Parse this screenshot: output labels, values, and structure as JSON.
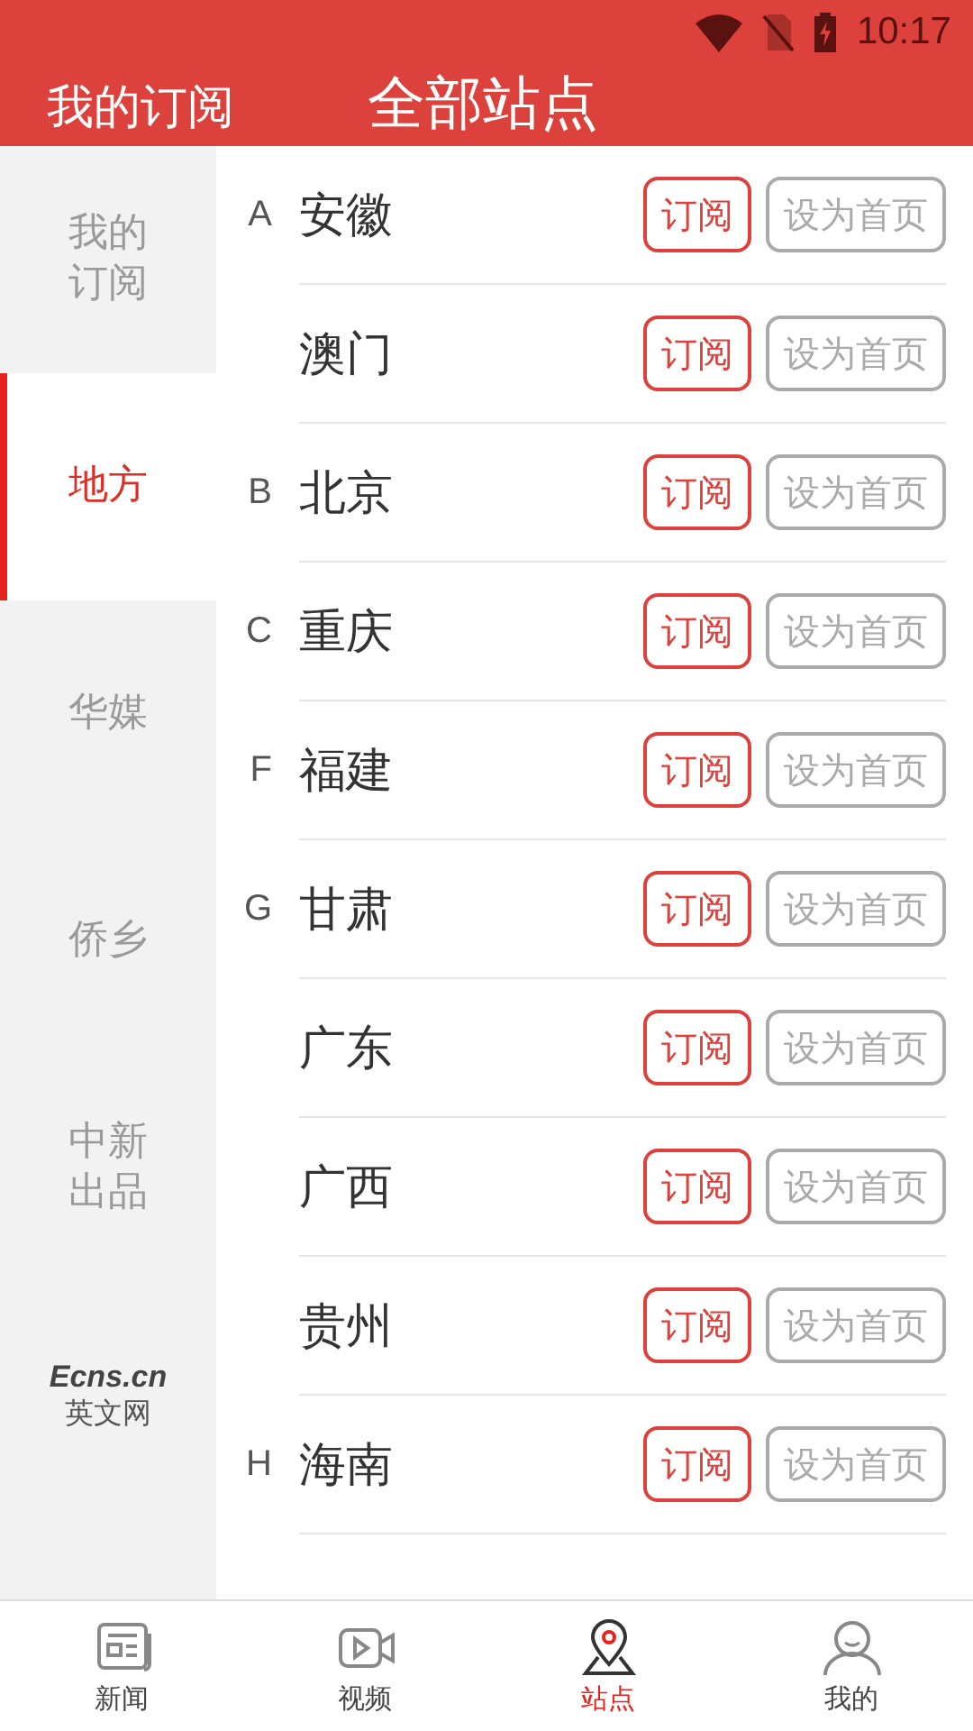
{
  "status_bar": {
    "time": "10:17"
  },
  "header": {
    "tab": "我的订阅",
    "title": "全部站点"
  },
  "sidebar": {
    "items": [
      {
        "kind": "text",
        "label": "我的订阅",
        "selected": false
      },
      {
        "kind": "text",
        "label": "地方",
        "selected": true
      },
      {
        "kind": "text",
        "label": "华媒",
        "selected": false
      },
      {
        "kind": "text",
        "label": "侨乡",
        "selected": false
      },
      {
        "kind": "text",
        "label": "中新出品",
        "selected": false
      },
      {
        "kind": "logo",
        "logo": "Ecns.cn",
        "label": "英文网",
        "selected": false
      }
    ]
  },
  "stations": [
    {
      "letter": "A",
      "name": "安徽",
      "subscribe": "订阅",
      "homepage": "设为首页"
    },
    {
      "name": "澳门",
      "subscribe": "订阅",
      "homepage": "设为首页"
    },
    {
      "letter": "B",
      "name": "北京",
      "subscribe": "订阅",
      "homepage": "设为首页"
    },
    {
      "letter": "C",
      "name": "重庆",
      "subscribe": "订阅",
      "homepage": "设为首页"
    },
    {
      "letter": "F",
      "name": "福建",
      "subscribe": "订阅",
      "homepage": "设为首页"
    },
    {
      "letter": "G",
      "name": "甘肃",
      "subscribe": "订阅",
      "homepage": "设为首页"
    },
    {
      "name": "广东",
      "subscribe": "订阅",
      "homepage": "设为首页"
    },
    {
      "name": "广西",
      "subscribe": "订阅",
      "homepage": "设为首页"
    },
    {
      "name": "贵州",
      "subscribe": "订阅",
      "homepage": "设为首页"
    },
    {
      "letter": "H",
      "name": "海南",
      "subscribe": "订阅",
      "homepage": "设为首页"
    }
  ],
  "bottom_nav": [
    {
      "kind": "news",
      "label": "新闻",
      "selected": false
    },
    {
      "kind": "video",
      "label": "视频",
      "selected": false
    },
    {
      "kind": "station",
      "label": "站点",
      "selected": true
    },
    {
      "kind": "me",
      "label": "我的",
      "selected": false
    }
  ]
}
